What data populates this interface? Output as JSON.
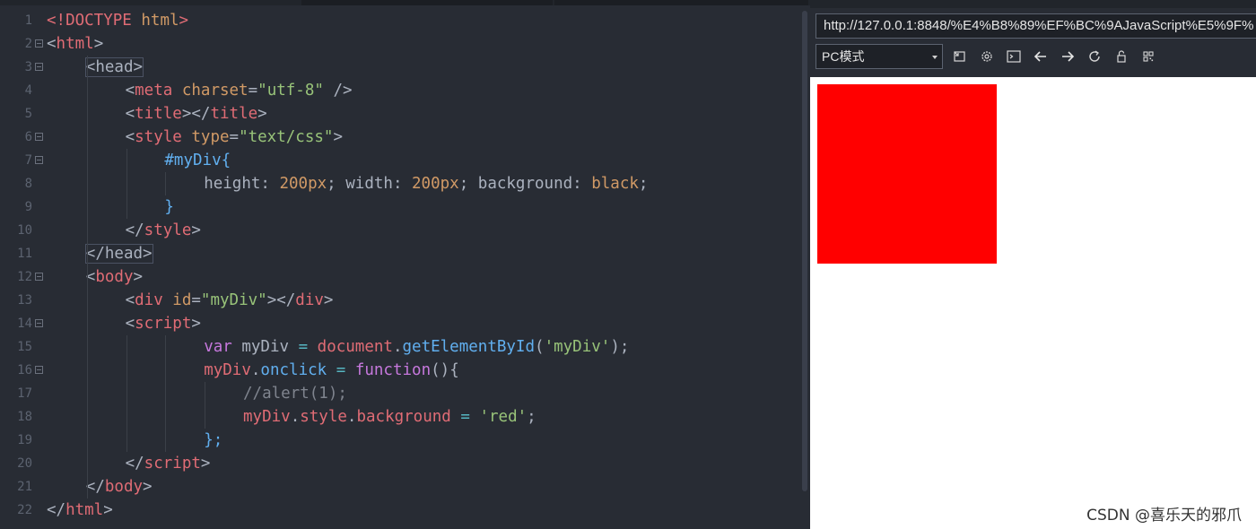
{
  "editor": {
    "line_numbers": [
      "1",
      "2",
      "3",
      "4",
      "5",
      "6",
      "7",
      "8",
      "9",
      "10",
      "11",
      "12",
      "13",
      "14",
      "15",
      "16",
      "17",
      "18",
      "19",
      "20",
      "21",
      "22"
    ],
    "lines": [
      {
        "tokens": [
          {
            "c": "t-tag",
            "t": "<!DOCTYPE"
          },
          {
            "c": "t-punct",
            "t": " "
          },
          {
            "c": "t-attr",
            "t": "html"
          },
          {
            "c": "t-tag",
            "t": ">"
          }
        ]
      },
      {
        "tokens": [
          {
            "c": "t-punct",
            "t": "<"
          },
          {
            "c": "t-tag",
            "t": "html"
          },
          {
            "c": "t-punct",
            "t": ">"
          }
        ]
      },
      {
        "tokens": [
          {
            "c": "t-punct hl",
            "t": "<head>"
          }
        ]
      },
      {
        "tokens": [
          {
            "c": "t-punct",
            "t": "<"
          },
          {
            "c": "t-tag",
            "t": "meta"
          },
          {
            "c": "t-punct",
            "t": " "
          },
          {
            "c": "t-attr",
            "t": "charset"
          },
          {
            "c": "t-punct",
            "t": "="
          },
          {
            "c": "t-str",
            "t": "\"utf-8\""
          },
          {
            "c": "t-punct",
            "t": " />"
          }
        ]
      },
      {
        "tokens": [
          {
            "c": "t-punct",
            "t": "<"
          },
          {
            "c": "t-tag",
            "t": "title"
          },
          {
            "c": "t-punct",
            "t": "></"
          },
          {
            "c": "t-tag",
            "t": "title"
          },
          {
            "c": "t-punct",
            "t": ">"
          }
        ]
      },
      {
        "tokens": [
          {
            "c": "t-punct",
            "t": "<"
          },
          {
            "c": "t-tag",
            "t": "style"
          },
          {
            "c": "t-punct",
            "t": " "
          },
          {
            "c": "t-attr",
            "t": "type"
          },
          {
            "c": "t-punct",
            "t": "="
          },
          {
            "c": "t-str",
            "t": "\"text/css\""
          },
          {
            "c": "t-punct",
            "t": ">"
          }
        ]
      },
      {
        "tokens": [
          {
            "c": "t-sel",
            "t": "#myDiv{"
          }
        ]
      },
      {
        "tokens": [
          {
            "c": "t-prop",
            "t": "height"
          },
          {
            "c": "t-punct",
            "t": ": "
          },
          {
            "c": "t-num",
            "t": "200px"
          },
          {
            "c": "t-punct",
            "t": "; "
          },
          {
            "c": "t-prop",
            "t": "width"
          },
          {
            "c": "t-punct",
            "t": ": "
          },
          {
            "c": "t-num",
            "t": "200px"
          },
          {
            "c": "t-punct",
            "t": "; "
          },
          {
            "c": "t-prop",
            "t": "background"
          },
          {
            "c": "t-punct",
            "t": ": "
          },
          {
            "c": "t-num",
            "t": "black"
          },
          {
            "c": "t-punct",
            "t": ";"
          }
        ]
      },
      {
        "tokens": [
          {
            "c": "t-sel",
            "t": "}"
          }
        ]
      },
      {
        "tokens": [
          {
            "c": "t-punct",
            "t": "</"
          },
          {
            "c": "t-tag",
            "t": "style"
          },
          {
            "c": "t-punct",
            "t": ">"
          }
        ]
      },
      {
        "tokens": [
          {
            "c": "t-punct hl",
            "t": "</head>"
          }
        ]
      },
      {
        "tokens": [
          {
            "c": "t-punct",
            "t": "<"
          },
          {
            "c": "t-tag",
            "t": "body"
          },
          {
            "c": "t-punct",
            "t": ">"
          }
        ]
      },
      {
        "tokens": [
          {
            "c": "t-punct",
            "t": "<"
          },
          {
            "c": "t-tag",
            "t": "div"
          },
          {
            "c": "t-punct",
            "t": " "
          },
          {
            "c": "t-attr",
            "t": "id"
          },
          {
            "c": "t-punct",
            "t": "="
          },
          {
            "c": "t-str",
            "t": "\"myDiv\""
          },
          {
            "c": "t-punct",
            "t": "></"
          },
          {
            "c": "t-tag",
            "t": "div"
          },
          {
            "c": "t-punct",
            "t": ">"
          }
        ]
      },
      {
        "tokens": [
          {
            "c": "t-punct",
            "t": "<"
          },
          {
            "c": "t-tag",
            "t": "script"
          },
          {
            "c": "t-punct",
            "t": ">"
          }
        ]
      },
      {
        "tokens": [
          {
            "c": "t-kw",
            "t": "var"
          },
          {
            "c": "t-punct",
            "t": " myDiv "
          },
          {
            "c": "t-op",
            "t": "="
          },
          {
            "c": "t-punct",
            "t": " "
          },
          {
            "c": "t-var",
            "t": "document"
          },
          {
            "c": "t-punct",
            "t": "."
          },
          {
            "c": "t-fn",
            "t": "getElementById"
          },
          {
            "c": "t-punct",
            "t": "("
          },
          {
            "c": "t-str",
            "t": "'myDiv'"
          },
          {
            "c": "t-punct",
            "t": ");"
          }
        ]
      },
      {
        "tokens": [
          {
            "c": "t-var",
            "t": "myDiv"
          },
          {
            "c": "t-punct",
            "t": "."
          },
          {
            "c": "t-fn",
            "t": "onclick"
          },
          {
            "c": "t-punct",
            "t": " "
          },
          {
            "c": "t-op",
            "t": "="
          },
          {
            "c": "t-punct",
            "t": " "
          },
          {
            "c": "t-kw",
            "t": "function"
          },
          {
            "c": "t-punct",
            "t": "(){"
          }
        ]
      },
      {
        "tokens": [
          {
            "c": "t-com",
            "t": "//alert(1);"
          }
        ]
      },
      {
        "tokens": [
          {
            "c": "t-var",
            "t": "myDiv"
          },
          {
            "c": "t-punct",
            "t": "."
          },
          {
            "c": "t-var",
            "t": "style"
          },
          {
            "c": "t-punct",
            "t": "."
          },
          {
            "c": "t-var",
            "t": "background"
          },
          {
            "c": "t-punct",
            "t": " "
          },
          {
            "c": "t-op",
            "t": "="
          },
          {
            "c": "t-punct",
            "t": " "
          },
          {
            "c": "t-str",
            "t": "'red'"
          },
          {
            "c": "t-punct",
            "t": ";"
          }
        ]
      },
      {
        "tokens": [
          {
            "c": "t-sel",
            "t": "};"
          }
        ]
      },
      {
        "tokens": [
          {
            "c": "t-punct",
            "t": "</"
          },
          {
            "c": "t-tag",
            "t": "script"
          },
          {
            "c": "t-punct",
            "t": ">"
          }
        ]
      },
      {
        "tokens": [
          {
            "c": "t-punct",
            "t": "</"
          },
          {
            "c": "t-tag",
            "t": "body"
          },
          {
            "c": "t-punct",
            "t": ">"
          }
        ]
      },
      {
        "tokens": [
          {
            "c": "t-punct",
            "t": "</"
          },
          {
            "c": "t-tag",
            "t": "html"
          },
          {
            "c": "t-punct",
            "t": ">"
          }
        ]
      }
    ]
  },
  "browser": {
    "url": "http://127.0.0.1:8848/%E4%B8%89%EF%BC%9AJavaScript%E5%9F%",
    "mode_label": "PC模式",
    "toolbar_icons": [
      "window-icon",
      "settings-icon",
      "terminal-icon",
      "back-arrow-icon",
      "forward-arrow-icon",
      "refresh-icon",
      "lock-icon",
      "qrcode-icon"
    ],
    "page_div_color": "#ff0000"
  },
  "watermark": "CSDN @喜乐天的邪爪",
  "colors": {
    "editor_bg": "#282c34",
    "tag": "#e06c75",
    "attr": "#d19a66",
    "string": "#98c379",
    "keyword": "#c678dd",
    "function": "#61afef"
  }
}
